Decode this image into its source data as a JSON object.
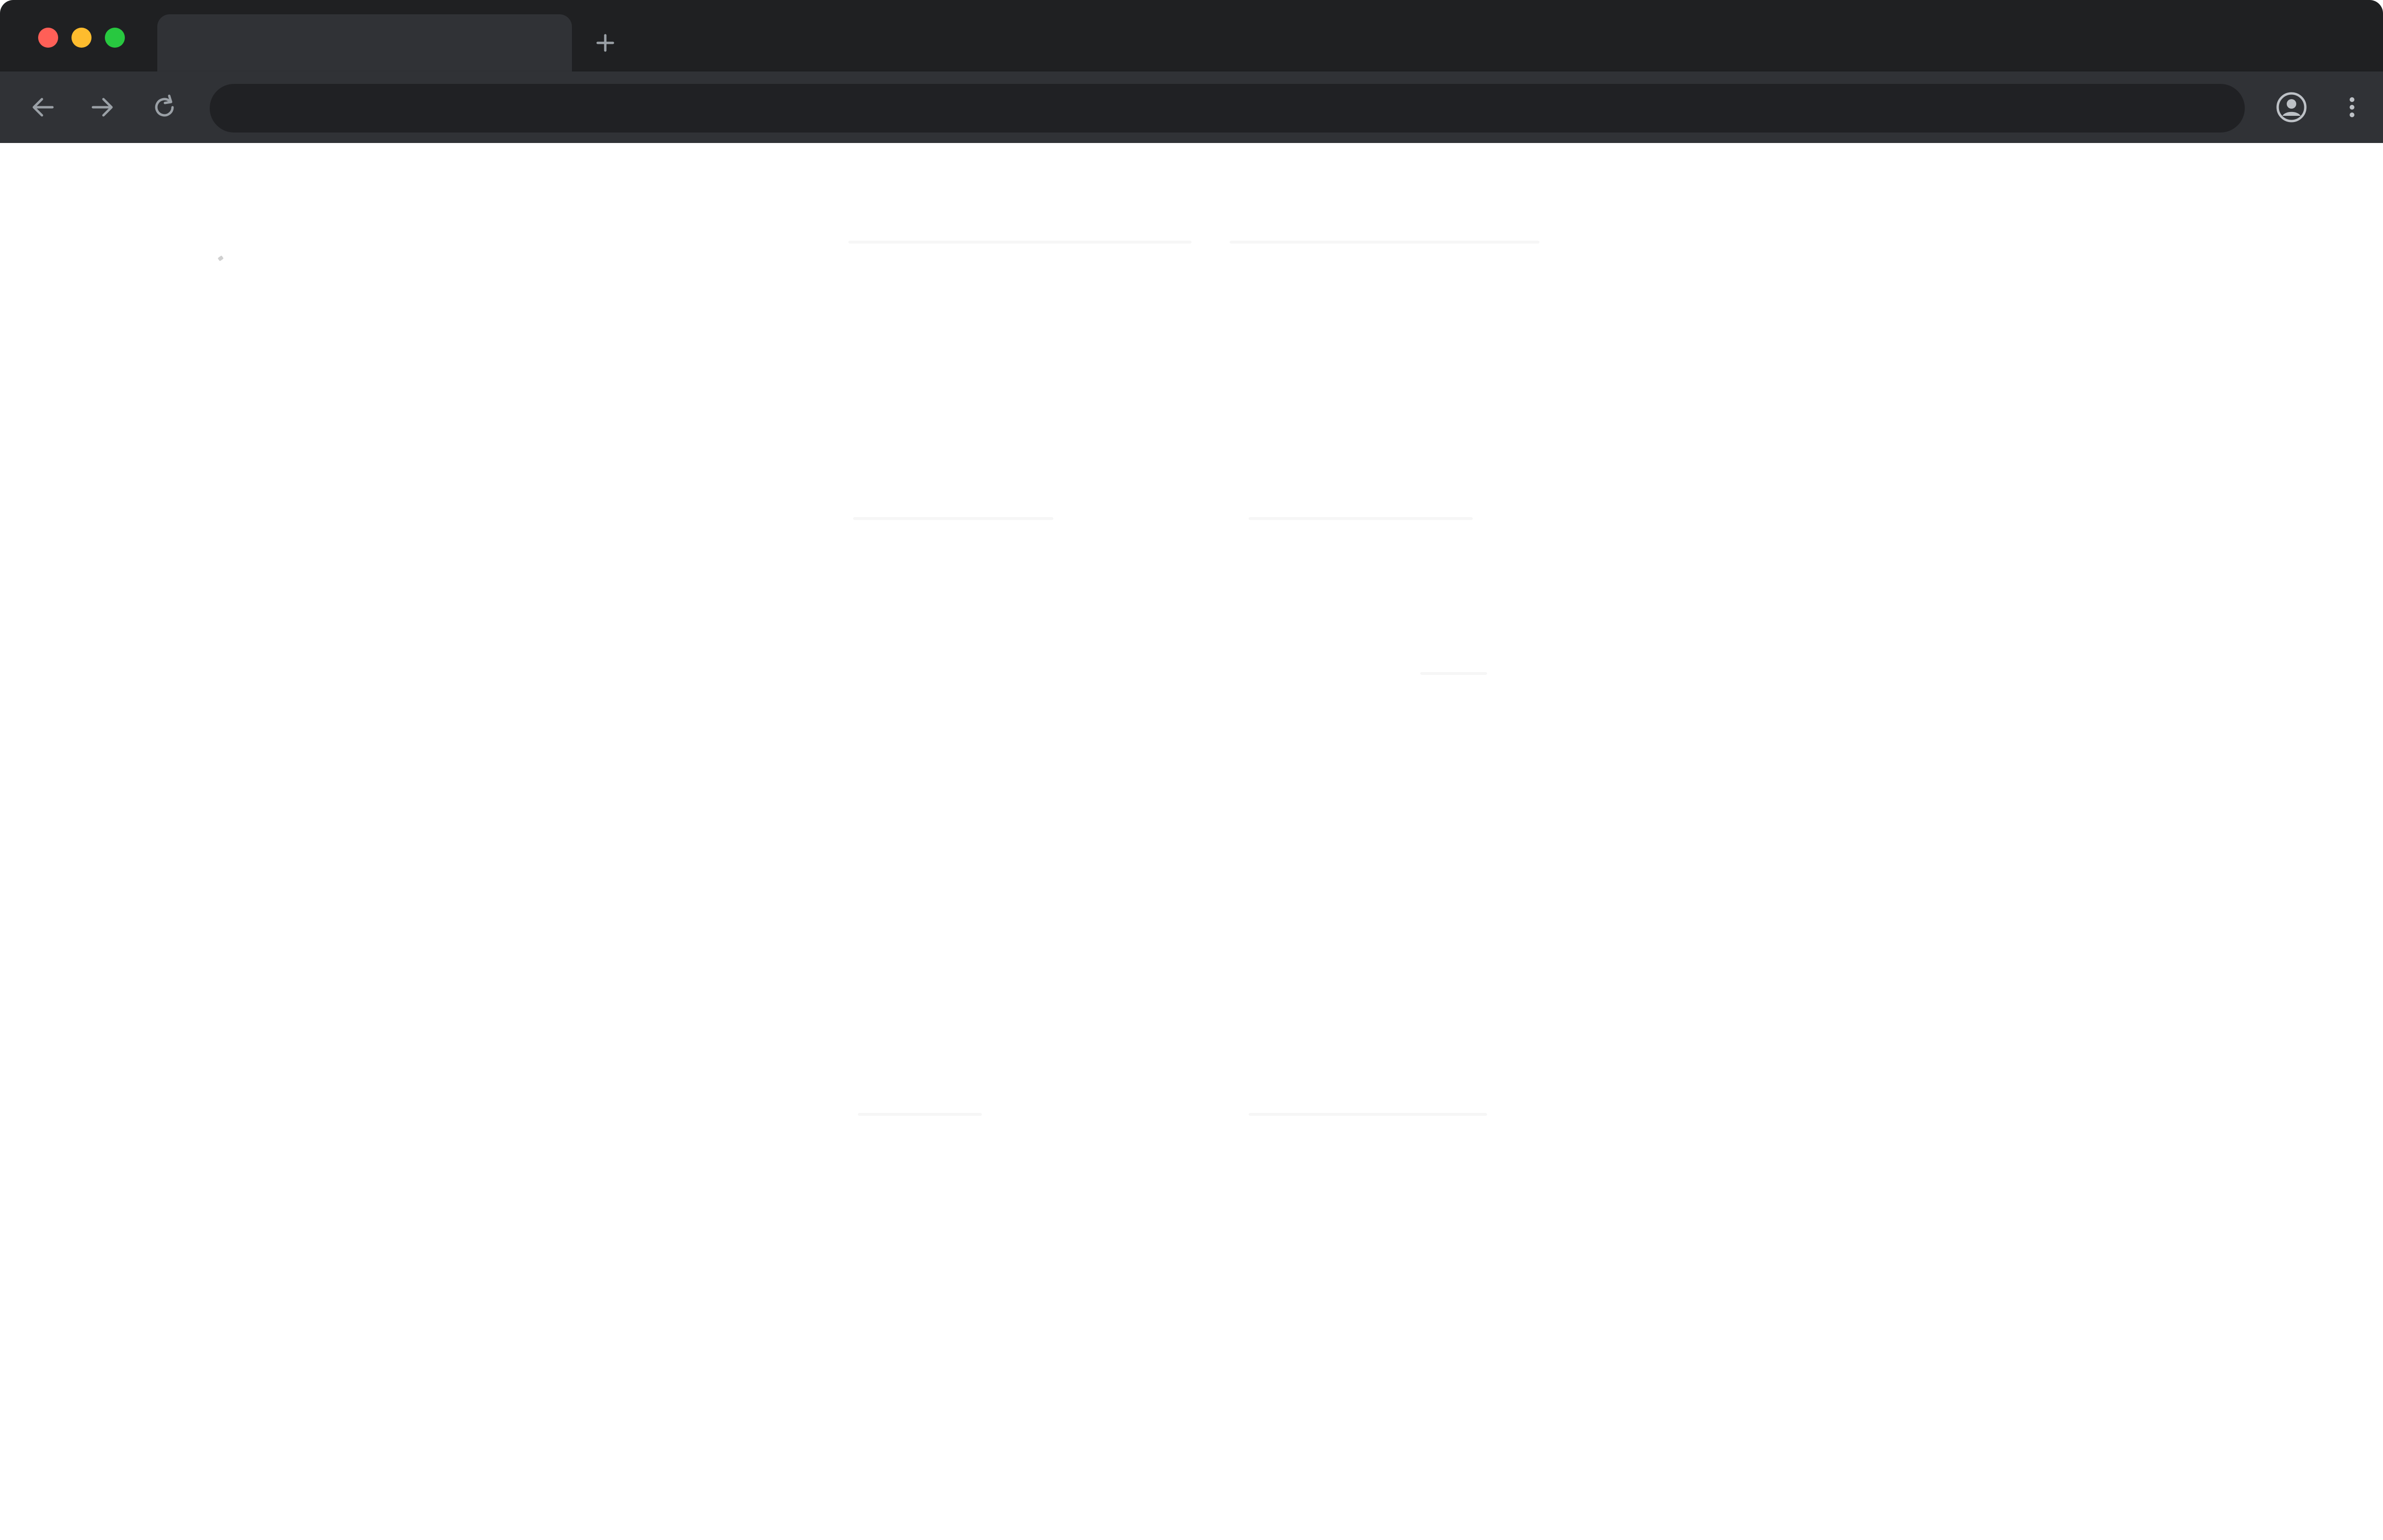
{
  "browser": {
    "tab": {
      "title": ""
    },
    "new_tab_icon": "plus-icon",
    "toolbar": {
      "back_icon": "arrow-left-icon",
      "forward_icon": "arrow-right-icon",
      "reload_icon": "reload-icon",
      "address": {
        "value": "",
        "placeholder": ""
      },
      "profile_icon": "account-circle-icon",
      "menu_icon": "kebab-menu-icon"
    },
    "window_controls": {
      "close_color": "#ff5f57",
      "minimize_color": "#febc2e",
      "zoom_color": "#28c840"
    }
  },
  "page": {
    "background": "#ffffff",
    "state": "blank"
  }
}
